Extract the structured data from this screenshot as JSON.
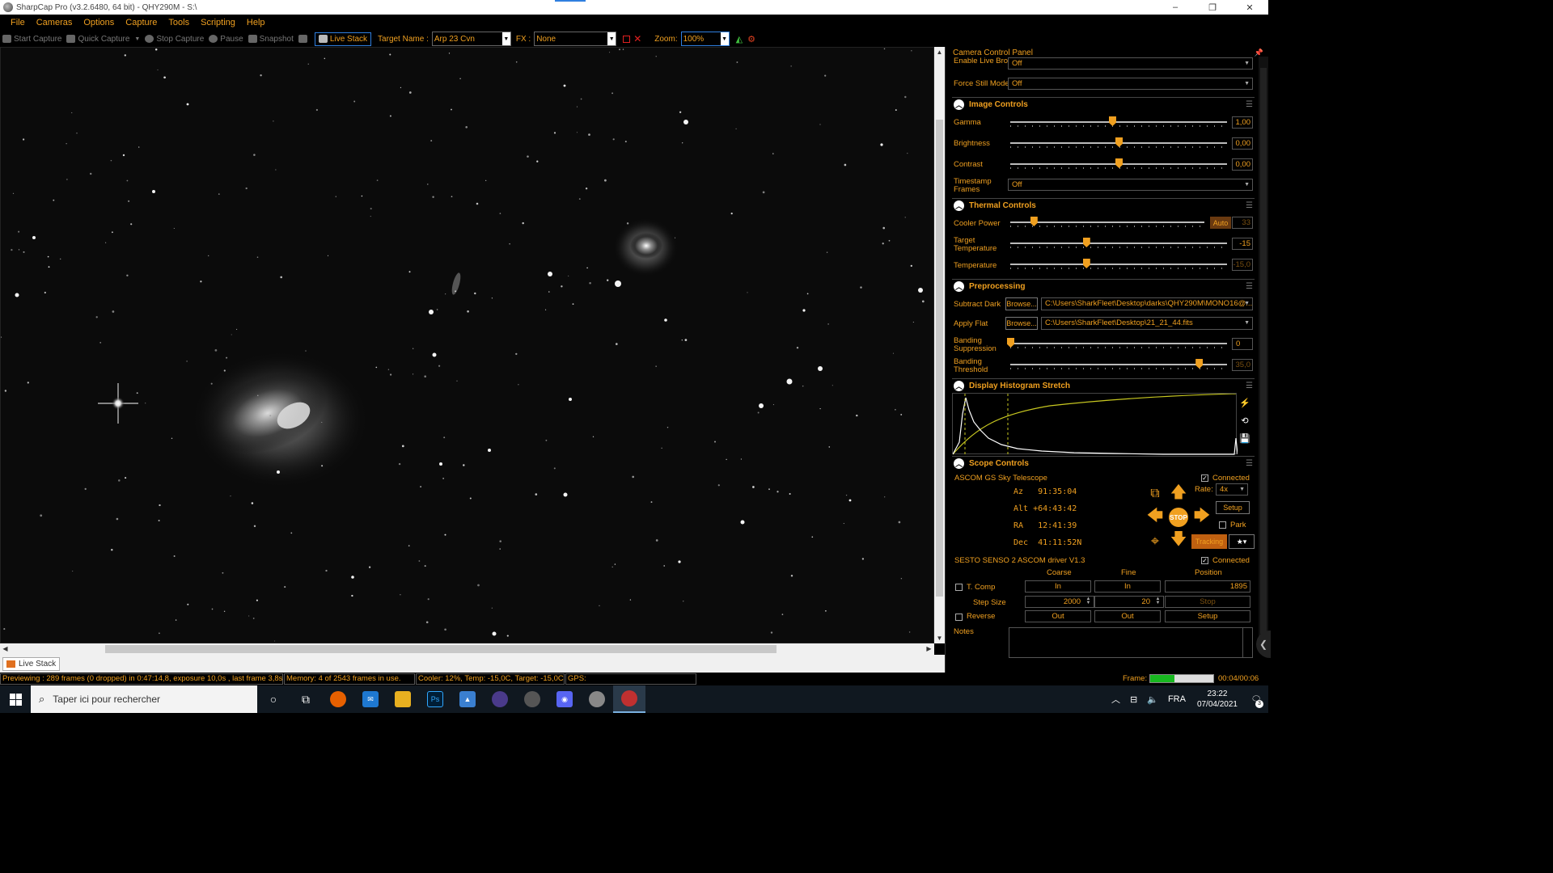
{
  "window": {
    "title": "SharpCap Pro (v3.2.6480, 64 bit) - QHY290M - S:\\",
    "minimize": "–",
    "maximize": "❐",
    "close": "✕"
  },
  "menu": [
    "File",
    "Cameras",
    "Options",
    "Capture",
    "Tools",
    "Scripting",
    "Help"
  ],
  "toolbar": {
    "start_capture": "Start Capture",
    "quick_capture": "Quick Capture",
    "stop_capture": "Stop Capture",
    "pause": "Pause",
    "snapshot": "Snapshot",
    "live_stack": "Live Stack",
    "target_name_label": "Target Name :",
    "target_name_value": "Arp 23 Cvn",
    "fx_label": "FX :",
    "fx_value": "None",
    "zoom_label": "Zoom:",
    "zoom_value": "100%"
  },
  "panel": {
    "title": "Camera Control Panel",
    "enable_live_broadcast_label": "Enable Live Broadcast",
    "enable_live_broadcast_value": "Off",
    "force_still_mode_label": "Force Still Mode",
    "force_still_mode_value": "Off",
    "image_controls": {
      "title": "Image Controls",
      "gamma_label": "Gamma",
      "gamma_value": "1,00",
      "gamma_pos": 0.47,
      "brightness_label": "Brightness",
      "brightness_value": "0,00",
      "brightness_pos": 0.5,
      "contrast_label": "Contrast",
      "contrast_value": "0,00",
      "contrast_pos": 0.5,
      "timestamp_label": "Timestamp Frames",
      "timestamp_value": "Off"
    },
    "thermal_controls": {
      "title": "Thermal Controls",
      "cooler_power_label": "Cooler Power",
      "cooler_power_auto": "Auto",
      "cooler_power_value": "33",
      "cooler_power_pos": 0.12,
      "target_temp_label": "Target Temperature",
      "target_temp_value": "-15",
      "target_temp_pos": 0.35,
      "temperature_label": "Temperature",
      "temperature_value": "-15,0",
      "temperature_pos": 0.35
    },
    "preprocessing": {
      "title": "Preprocessing",
      "subtract_dark_label": "Subtract Dark",
      "subtract_dark_browse": "Browse...",
      "subtract_dark_path": "C:\\Users\\SharkFleet\\Desktop\\darks\\QHY290M\\MONO16@...",
      "apply_flat_label": "Apply Flat",
      "apply_flat_browse": "Browse...",
      "apply_flat_path": "C:\\Users\\SharkFleet\\Desktop\\21_21_44.fits",
      "banding_suppression_label": "Banding Suppression",
      "banding_suppression_value": "0",
      "banding_suppression_pos": 0.0,
      "banding_threshold_label": "Banding Threshold",
      "banding_threshold_value": "35,0",
      "banding_threshold_pos": 0.87
    },
    "histogram": {
      "title": "Display Histogram Stretch"
    },
    "scope_controls": {
      "title": "Scope Controls",
      "telescope_name": "ASCOM GS Sky Telescope",
      "connected_label": "Connected",
      "az": "Az   91:35:04",
      "alt": "Alt +64:43:42",
      "ra": "RA   12:41:39",
      "dec": "Dec  41:11:52N",
      "rate_label": "Rate:",
      "rate_value": "4x",
      "setup": "Setup",
      "park": "Park",
      "stop": "STOP",
      "tracking": "Tracking"
    },
    "focuser": {
      "name": "SESTO SENSO 2 ASCOM driver V1.3",
      "connected_label": "Connected",
      "coarse": "Coarse",
      "fine": "Fine",
      "position": "Position",
      "tcomp": "T. Comp",
      "coarse_in": "In",
      "fine_in": "In",
      "position_value": "1895",
      "step_size_label": "Step Size",
      "coarse_step": "2000",
      "fine_step": "20",
      "stop": "Stop",
      "reverse": "Reverse",
      "coarse_out": "Out",
      "fine_out": "Out",
      "setup": "Setup"
    },
    "notes_label": "Notes"
  },
  "bottom_tab": "Live Stack",
  "status": {
    "previewing": "Previewing : 289 frames (0 dropped) in 0:47:14,8, exposure 10,0s , last frame 3,8s",
    "memory": "Memory: 4 of 2543 frames in use.",
    "cooler": "Cooler: 12%, Temp: -15,0C, Target: -15,0C",
    "gps": "GPS:",
    "frame_label": "Frame:",
    "frame_progress": 0.38,
    "frame_time": "00:04/00:06"
  },
  "taskbar": {
    "search_placeholder": "Taper ici pour rechercher",
    "lang": "FRA",
    "time": "23:22",
    "date": "07/04/2021",
    "notif_count": "3"
  }
}
